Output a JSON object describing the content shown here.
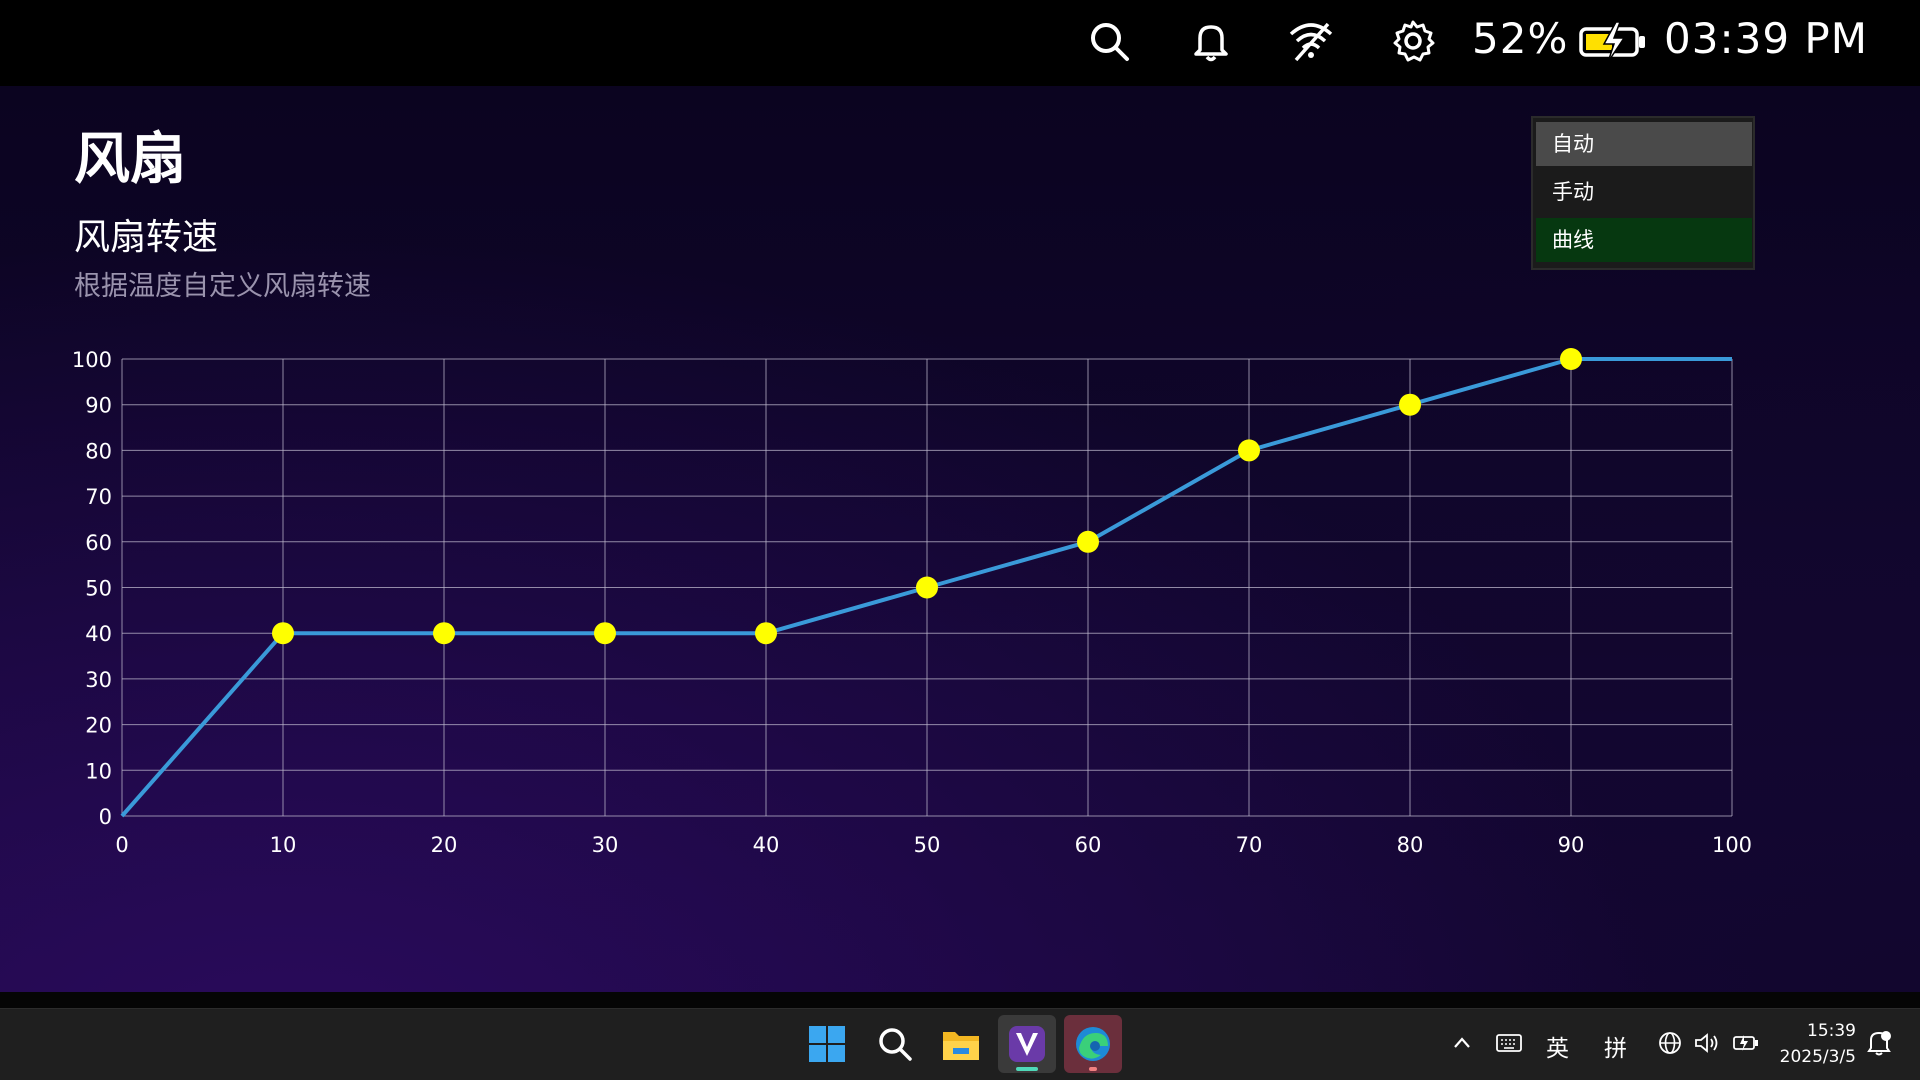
{
  "status_bar": {
    "battery_percent": "52%",
    "time": "03:39 PM",
    "icons": [
      "search-icon",
      "bell-icon",
      "wifi-off-icon",
      "gear-icon",
      "battery-charging-icon"
    ]
  },
  "page": {
    "title": "风扇",
    "section_title": "风扇转速",
    "section_subtitle": "根据温度自定义风扇转速"
  },
  "mode_menu": {
    "items": [
      {
        "label": "自动",
        "state": "hover"
      },
      {
        "label": "手动",
        "state": "normal"
      },
      {
        "label": "曲线",
        "state": "selected"
      }
    ],
    "selected_color": "#063810"
  },
  "chart_data": {
    "type": "line",
    "title": "",
    "xlabel": "",
    "ylabel": "",
    "xlim": [
      0,
      100
    ],
    "ylim": [
      0,
      100
    ],
    "x_ticks": [
      "0",
      "10",
      "20",
      "30",
      "40",
      "50",
      "60",
      "70",
      "80",
      "90",
      "100"
    ],
    "y_ticks": [
      "0",
      "10",
      "20",
      "30",
      "40",
      "50",
      "60",
      "70",
      "80",
      "90",
      "100"
    ],
    "grid": true,
    "series": [
      {
        "x": [
          0,
          10,
          20,
          30,
          40,
          50,
          60,
          70,
          80,
          90,
          100
        ],
        "y": [
          0,
          40,
          40,
          40,
          40,
          50,
          60,
          80,
          90,
          100,
          100
        ],
        "color": "#3a9ad9"
      }
    ],
    "points": [
      {
        "x": 10,
        "y": 40
      },
      {
        "x": 20,
        "y": 40
      },
      {
        "x": 30,
        "y": 40
      },
      {
        "x": 40,
        "y": 40
      },
      {
        "x": 50,
        "y": 50
      },
      {
        "x": 60,
        "y": 60
      },
      {
        "x": 70,
        "y": 80
      },
      {
        "x": 80,
        "y": 90
      },
      {
        "x": 90,
        "y": 100
      }
    ],
    "point_color": "#ffff00",
    "grid_color": "#bdb7cc"
  },
  "taskbar": {
    "apps": [
      "windows-start-icon",
      "search-icon",
      "file-explorer-icon",
      "app-v-icon",
      "edge-icon"
    ],
    "tray": {
      "ime_lang": "英",
      "ime_mode": "拼",
      "time": "15:39",
      "date": "2025/3/5"
    }
  }
}
